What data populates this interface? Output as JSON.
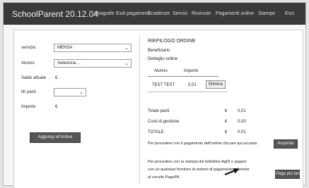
{
  "header": {
    "brand": "SchoolParent 20.12.04",
    "nav": [
      "Anagrafe",
      "Esiti pagamenti",
      "Scadenze",
      "Servizi",
      "Ricevute",
      "Pagamenti online",
      "Stampe",
      "Esci"
    ]
  },
  "form": {
    "servizio_label": "servizio",
    "servizio_value": "MENSA",
    "alunno_label": "Alunno",
    "alunno_value": "Seleziona ...",
    "saldo_label": "Saldo attuale",
    "saldo_currency": "€",
    "npasti_label": "Nr pasti",
    "npasti_value": "",
    "importo_label": "Importo",
    "importo_currency": "€",
    "add_button": "Aggiungi all'ordine"
  },
  "summary": {
    "title": "RIEPILOGO ORDINE",
    "beneficiario": "Beneficiario",
    "dettaglio": "Dettaglio ordine",
    "columns": [
      "Alunno",
      "Importo"
    ],
    "rows": [
      {
        "alunno": "TEST TEST",
        "importo": "0,01",
        "action": "Elimina"
      }
    ],
    "totale_pasti_label": "Totale pasti",
    "totale_pasti_currency": "€",
    "totale_pasti_value": "0,01",
    "costi_label": "Costi di gestione",
    "costi_currency": "€",
    "costi_value": "0,00",
    "totale_label": "TOTALE",
    "totale_currency": "€",
    "totale_value": "0,01",
    "pay_text": "Per procedere con il pagamento dell'ordine cliccare qui accanto",
    "pay_button": "Acquista",
    "bollettino_text_1": "Per procedere con la stampa del bollettino AgID e pagare",
    "bollettino_text_2": "con un qualsiasi fornitore di sistemi di pagamento aderente",
    "bollettino_text_3": "al circuito PagoPA",
    "bollettino_button": "Paga più tardi"
  }
}
